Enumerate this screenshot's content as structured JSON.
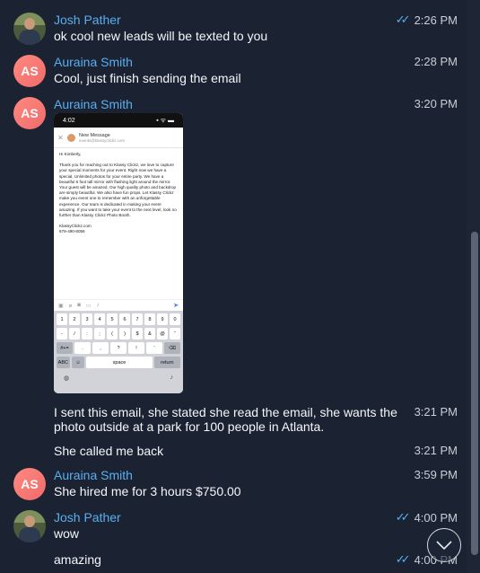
{
  "messages": {
    "m1": {
      "sender": "Josh Pather",
      "text": "ok cool new leads will be texted to you",
      "time": "2:26 PM",
      "read_check": "✓✓"
    },
    "m2": {
      "sender": "Auraina Smith",
      "initials": "AS",
      "text": "Cool, just finish sending the email",
      "time": "2:28 PM"
    },
    "m3": {
      "sender": "Auraina Smith",
      "initials": "AS",
      "time": "3:20 PM"
    },
    "m4": {
      "text_line1": "I sent this email, she stated she read the email, she wants the",
      "text_line2": "photo outside at a park for 100 people in Atlanta.",
      "time": "3:21 PM"
    },
    "m5": {
      "text": "She called me back",
      "time": "3:21 PM"
    },
    "m6": {
      "sender": "Auraina Smith",
      "initials": "AS",
      "text": "She hired me for 3 hours $750.00",
      "time": "3:59 PM"
    },
    "m7": {
      "sender": "Josh Pather",
      "text": "wow",
      "time": "4:00 PM",
      "read_check": "✓✓"
    },
    "m8": {
      "text": "amazing",
      "time": "4:00 PM",
      "read_check": "✓✓"
    }
  },
  "screenshot": {
    "status_time": "4:02",
    "status_icons": "▪ ᯤ ▬",
    "title": "New Message",
    "from": "events@klassyclickz.com",
    "greeting": "Hi Kimberly,",
    "body": "Thank you for reaching out to Klassy Clickz, we love to capture your special moments for your event. Right now we have a special, Unlimited photos for your entire party. We have a beautiful 6 foot tall mirror with flashing light around the mirror. Your guest will be amazed. Our high quality photo and backdrop are simply beautiful. We also have fun props. Let Klassy Clickz make you event one to remember with an unforgettable experience. Our team is dedicated in making your event amazing. If you want to take your event to the next level, look no further than Klassy Clickz Photo Booth.",
    "signature_name": "KlassyClickz.com",
    "signature_phone": "678-490-8056",
    "keys_row1": [
      "1",
      "2",
      "3",
      "4",
      "5",
      "6",
      "7",
      "8",
      "9",
      "0"
    ],
    "keys_row2": [
      "-",
      "/",
      ":",
      ";",
      "(",
      ")",
      "$",
      "&",
      "@",
      "“"
    ],
    "keys_row3": [
      "#+=",
      ".",
      ",",
      "?",
      "!",
      "’",
      "⌫"
    ],
    "key_abc": "ABC",
    "key_space": "space",
    "key_return": "return"
  },
  "icons": {
    "down": "chevron-down-icon",
    "globe": "globe-icon",
    "mic": "mic-icon",
    "send": "send-icon"
  },
  "colors": {
    "background": "#1b2332",
    "name": "#5aaef0",
    "avatar": "#f06a6a"
  }
}
